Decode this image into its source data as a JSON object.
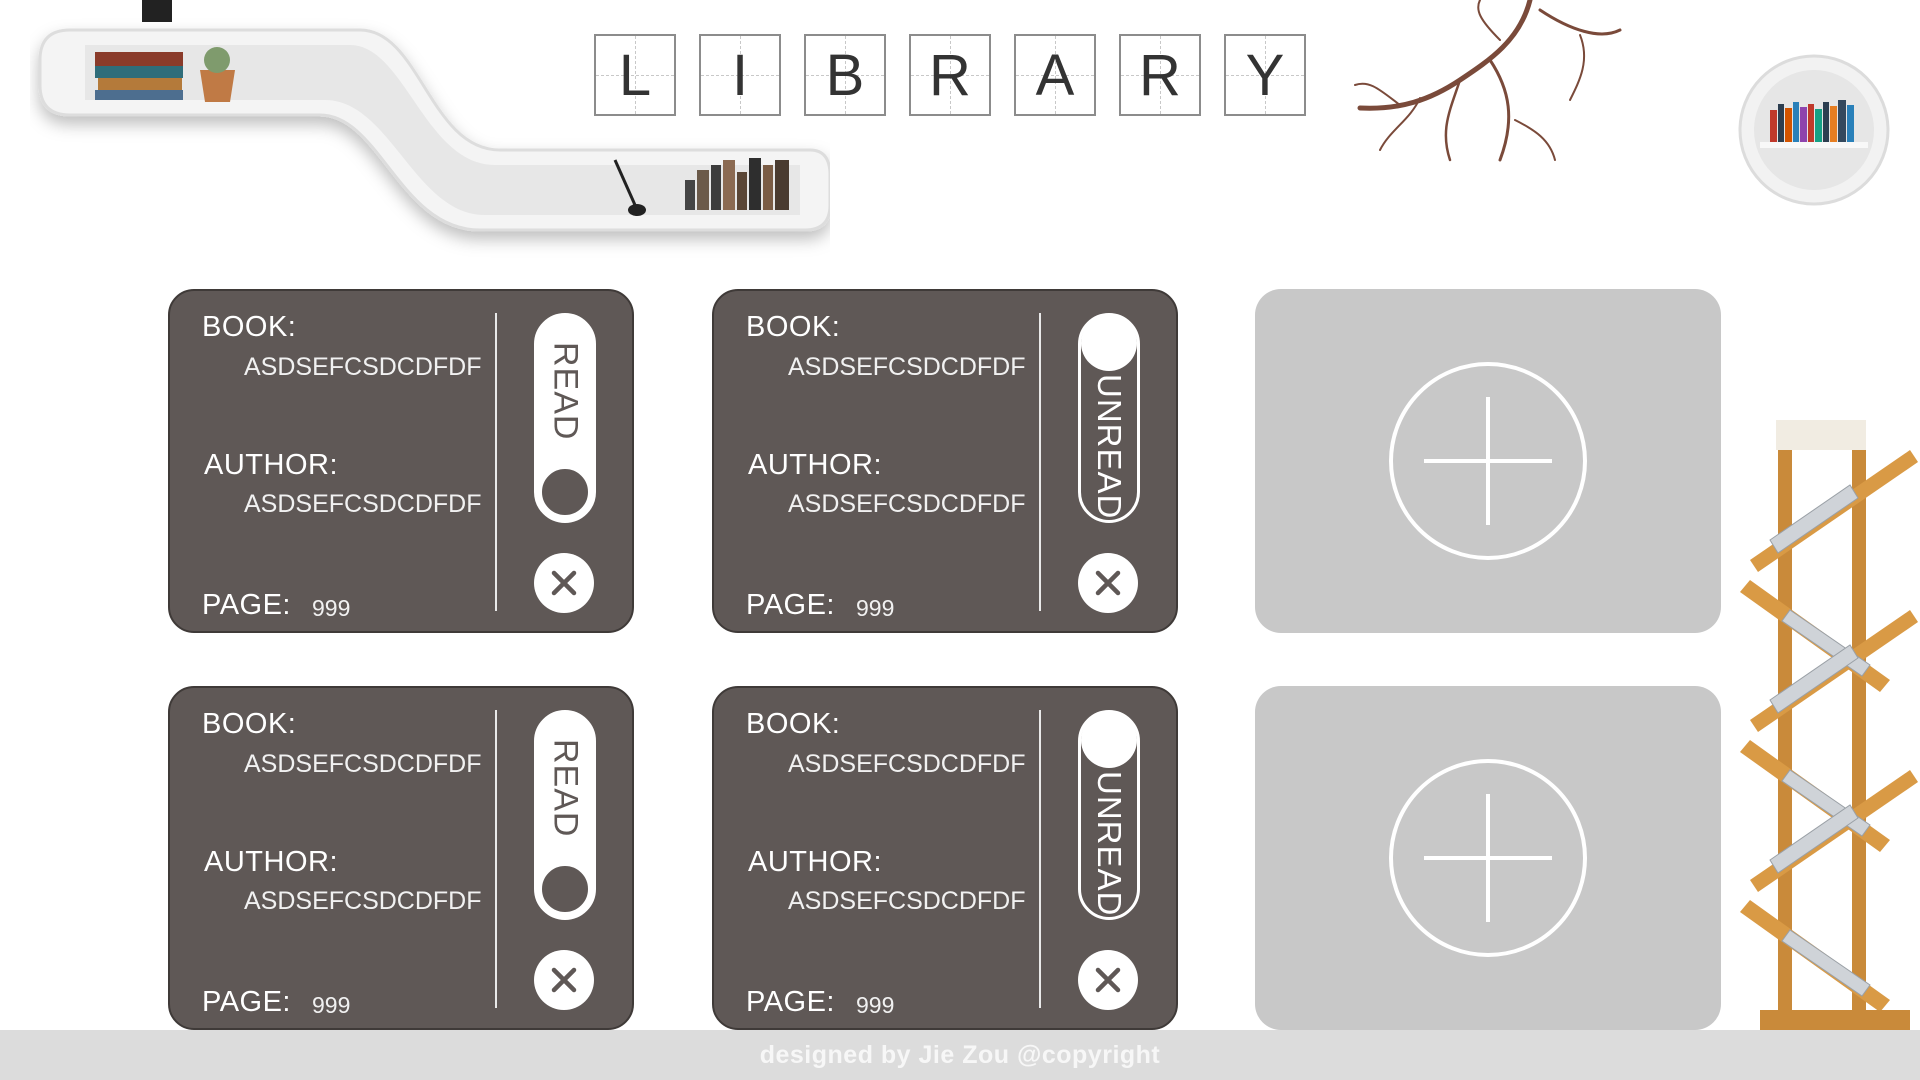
{
  "title": {
    "letters": [
      "L",
      "I",
      "B",
      "R",
      "A",
      "R",
      "Y"
    ]
  },
  "cards": [
    {
      "book_label": "BOOK:",
      "book": "ASDSEFCSDCDFDF",
      "author_label": "AUTHOR:",
      "author": "ASDSEFCSDCDFDF",
      "page_label": "PAGE:",
      "page": "999",
      "status": "READ"
    },
    {
      "book_label": "BOOK:",
      "book": "ASDSEFCSDCDFDF",
      "author_label": "AUTHOR:",
      "author": "ASDSEFCSDCDFDF",
      "page_label": "PAGE:",
      "page": "999",
      "status": "UNREAD"
    },
    {
      "book_label": "BOOK:",
      "book": "ASDSEFCSDCDFDF",
      "author_label": "AUTHOR:",
      "author": "ASDSEFCSDCDFDF",
      "page_label": "PAGE:",
      "page": "999",
      "status": "READ"
    },
    {
      "book_label": "BOOK:",
      "book": "ASDSEFCSDCDFDF",
      "author_label": "AUTHOR:",
      "author": "ASDSEFCSDCDFDF",
      "page_label": "PAGE:",
      "page": "999",
      "status": "UNREAD"
    }
  ],
  "add_cards": [
    {
      "icon": "plus-circle-icon"
    },
    {
      "icon": "plus-circle-icon"
    }
  ],
  "icons": {
    "close": "close-icon",
    "add": "plus-circle-icon"
  },
  "colors": {
    "card_bg": "#5f5856",
    "add_card_bg": "#c8c8c8",
    "footer_bg": "#dcdcdc",
    "text": "#ffffff"
  },
  "footer": {
    "text": "designed by Jie Zou @copyright"
  }
}
